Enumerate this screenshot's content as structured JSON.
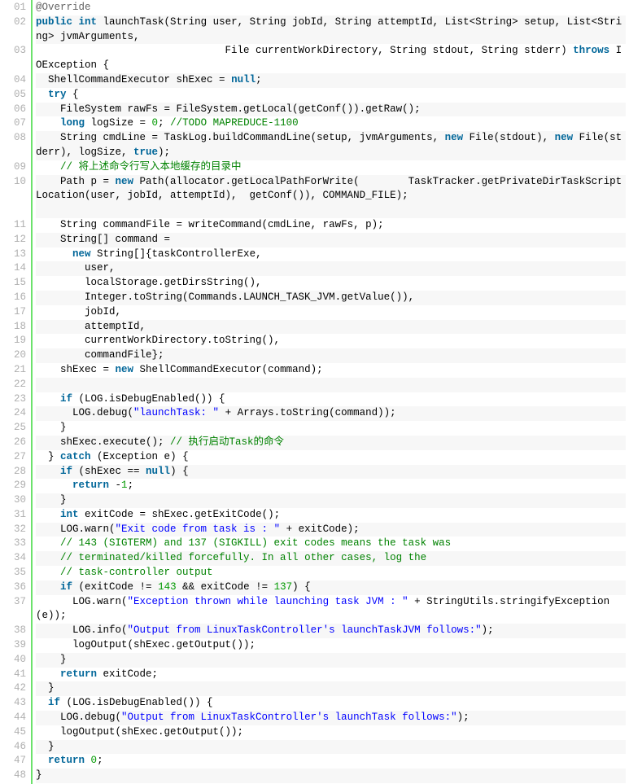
{
  "lines": [
    {
      "num": "01",
      "alt": false,
      "tokens": [
        [
          "anno",
          "@Override"
        ]
      ]
    },
    {
      "num": "02",
      "alt": true,
      "tokens": [
        [
          "kw",
          "public"
        ],
        [
          "plain",
          " "
        ],
        [
          "kw",
          "int"
        ],
        [
          "plain",
          " launchTask(String user, String jobId, String attemptId, List<String> setup, List<String> jvmArguments,"
        ]
      ]
    },
    {
      "num": "03",
      "alt": false,
      "tokens": [
        [
          "plain",
          "                               File currentWorkDirectory, String stdout, String stderr) "
        ],
        [
          "kw",
          "throws"
        ],
        [
          "plain",
          " IOException {"
        ]
      ]
    },
    {
      "num": "04",
      "alt": true,
      "tokens": [
        [
          "plain",
          "  ShellCommandExecutor shExec = "
        ],
        [
          "kw",
          "null"
        ],
        [
          "plain",
          ";"
        ]
      ]
    },
    {
      "num": "05",
      "alt": false,
      "tokens": [
        [
          "plain",
          "  "
        ],
        [
          "kw",
          "try"
        ],
        [
          "plain",
          " {"
        ]
      ]
    },
    {
      "num": "06",
      "alt": true,
      "tokens": [
        [
          "plain",
          "    FileSystem rawFs = FileSystem.getLocal(getConf()).getRaw();"
        ]
      ]
    },
    {
      "num": "07",
      "alt": false,
      "tokens": [
        [
          "plain",
          "    "
        ],
        [
          "kw",
          "long"
        ],
        [
          "plain",
          " logSize = "
        ],
        [
          "num",
          "0"
        ],
        [
          "plain",
          "; "
        ],
        [
          "comm",
          "//TODO MAPREDUCE-1100"
        ]
      ]
    },
    {
      "num": "08",
      "alt": true,
      "tokens": [
        [
          "plain",
          "    String cmdLine = TaskLog.buildCommandLine(setup, jvmArguments, "
        ],
        [
          "kw",
          "new"
        ],
        [
          "plain",
          " File(stdout), "
        ],
        [
          "kw",
          "new"
        ],
        [
          "plain",
          " File(stderr), logSize, "
        ],
        [
          "kw",
          "true"
        ],
        [
          "plain",
          ");"
        ]
      ]
    },
    {
      "num": "09",
      "alt": false,
      "tokens": [
        [
          "plain",
          "    "
        ],
        [
          "comm",
          "// 将上述命令行写入本地缓存的目录中"
        ]
      ]
    },
    {
      "num": "10",
      "alt": true,
      "tokens": [
        [
          "plain",
          "    Path p = "
        ],
        [
          "kw",
          "new"
        ],
        [
          "plain",
          " Path(allocator.getLocalPathForWrite(        TaskTracker.getPrivateDirTaskScriptLocation(user, jobId, attemptId),  getConf()), COMMAND_FILE);"
        ]
      ]
    },
    {
      "num": "11",
      "alt": false,
      "tokens": [
        [
          "plain",
          "    String commandFile = writeCommand(cmdLine, rawFs, p);"
        ]
      ]
    },
    {
      "num": "12",
      "alt": true,
      "tokens": [
        [
          "plain",
          "    String[] command ="
        ]
      ]
    },
    {
      "num": "13",
      "alt": false,
      "tokens": [
        [
          "plain",
          "      "
        ],
        [
          "kw",
          "new"
        ],
        [
          "plain",
          " String[]{taskControllerExe,"
        ]
      ]
    },
    {
      "num": "14",
      "alt": true,
      "tokens": [
        [
          "plain",
          "        user,"
        ]
      ]
    },
    {
      "num": "15",
      "alt": false,
      "tokens": [
        [
          "plain",
          "        localStorage.getDirsString(),"
        ]
      ]
    },
    {
      "num": "16",
      "alt": true,
      "tokens": [
        [
          "plain",
          "        Integer.toString(Commands.LAUNCH_TASK_JVM.getValue()),"
        ]
      ]
    },
    {
      "num": "17",
      "alt": false,
      "tokens": [
        [
          "plain",
          "        jobId,"
        ]
      ]
    },
    {
      "num": "18",
      "alt": true,
      "tokens": [
        [
          "plain",
          "        attemptId,"
        ]
      ]
    },
    {
      "num": "19",
      "alt": false,
      "tokens": [
        [
          "plain",
          "        currentWorkDirectory.toString(),"
        ]
      ]
    },
    {
      "num": "20",
      "alt": true,
      "tokens": [
        [
          "plain",
          "        commandFile};"
        ]
      ]
    },
    {
      "num": "21",
      "alt": false,
      "tokens": [
        [
          "plain",
          "    shExec = "
        ],
        [
          "kw",
          "new"
        ],
        [
          "plain",
          " ShellCommandExecutor(command);"
        ]
      ]
    },
    {
      "num": "22",
      "alt": true,
      "tokens": [
        [
          "plain",
          ""
        ]
      ]
    },
    {
      "num": "23",
      "alt": false,
      "tokens": [
        [
          "plain",
          "    "
        ],
        [
          "kw",
          "if"
        ],
        [
          "plain",
          " (LOG.isDebugEnabled()) {"
        ]
      ]
    },
    {
      "num": "24",
      "alt": true,
      "tokens": [
        [
          "plain",
          "      LOG.debug("
        ],
        [
          "str",
          "\"launchTask: \""
        ],
        [
          "plain",
          " + Arrays.toString(command));"
        ]
      ]
    },
    {
      "num": "25",
      "alt": false,
      "tokens": [
        [
          "plain",
          "    }"
        ]
      ]
    },
    {
      "num": "26",
      "alt": true,
      "tokens": [
        [
          "plain",
          "    shExec.execute(); "
        ],
        [
          "comm",
          "// 执行启动Task的命令"
        ]
      ]
    },
    {
      "num": "27",
      "alt": false,
      "tokens": [
        [
          "plain",
          "  } "
        ],
        [
          "kw",
          "catch"
        ],
        [
          "plain",
          " (Exception e) {"
        ]
      ]
    },
    {
      "num": "28",
      "alt": true,
      "tokens": [
        [
          "plain",
          "    "
        ],
        [
          "kw",
          "if"
        ],
        [
          "plain",
          " (shExec == "
        ],
        [
          "kw",
          "null"
        ],
        [
          "plain",
          ") {"
        ]
      ]
    },
    {
      "num": "29",
      "alt": false,
      "tokens": [
        [
          "plain",
          "      "
        ],
        [
          "kw",
          "return"
        ],
        [
          "plain",
          " -"
        ],
        [
          "num",
          "1"
        ],
        [
          "plain",
          ";"
        ]
      ]
    },
    {
      "num": "30",
      "alt": true,
      "tokens": [
        [
          "plain",
          "    }"
        ]
      ]
    },
    {
      "num": "31",
      "alt": false,
      "tokens": [
        [
          "plain",
          "    "
        ],
        [
          "kw",
          "int"
        ],
        [
          "plain",
          " exitCode = shExec.getExitCode();"
        ]
      ]
    },
    {
      "num": "32",
      "alt": true,
      "tokens": [
        [
          "plain",
          "    LOG.warn("
        ],
        [
          "str",
          "\"Exit code from task is : \""
        ],
        [
          "plain",
          " + exitCode);"
        ]
      ]
    },
    {
      "num": "33",
      "alt": false,
      "tokens": [
        [
          "plain",
          "    "
        ],
        [
          "comm",
          "// 143 (SIGTERM) and 137 (SIGKILL) exit codes means the task was"
        ]
      ]
    },
    {
      "num": "34",
      "alt": true,
      "tokens": [
        [
          "plain",
          "    "
        ],
        [
          "comm",
          "// terminated/killed forcefully. In all other cases, log the"
        ]
      ]
    },
    {
      "num": "35",
      "alt": false,
      "tokens": [
        [
          "plain",
          "    "
        ],
        [
          "comm",
          "// task-controller output"
        ]
      ]
    },
    {
      "num": "36",
      "alt": true,
      "tokens": [
        [
          "plain",
          "    "
        ],
        [
          "kw",
          "if"
        ],
        [
          "plain",
          " (exitCode != "
        ],
        [
          "num",
          "143"
        ],
        [
          "plain",
          " && exitCode != "
        ],
        [
          "num",
          "137"
        ],
        [
          "plain",
          ") {"
        ]
      ]
    },
    {
      "num": "37",
      "alt": false,
      "tokens": [
        [
          "plain",
          "      LOG.warn("
        ],
        [
          "str",
          "\"Exception thrown while launching task JVM : \""
        ],
        [
          "plain",
          " + StringUtils.stringifyException(e));"
        ]
      ]
    },
    {
      "num": "38",
      "alt": true,
      "tokens": [
        [
          "plain",
          "      LOG.info("
        ],
        [
          "str",
          "\"Output from LinuxTaskController's launchTaskJVM follows:\""
        ],
        [
          "plain",
          ");"
        ]
      ]
    },
    {
      "num": "39",
      "alt": false,
      "tokens": [
        [
          "plain",
          "      logOutput(shExec.getOutput());"
        ]
      ]
    },
    {
      "num": "40",
      "alt": true,
      "tokens": [
        [
          "plain",
          "    }"
        ]
      ]
    },
    {
      "num": "41",
      "alt": false,
      "tokens": [
        [
          "plain",
          "    "
        ],
        [
          "kw",
          "return"
        ],
        [
          "plain",
          " exitCode;"
        ]
      ]
    },
    {
      "num": "42",
      "alt": true,
      "tokens": [
        [
          "plain",
          "  }"
        ]
      ]
    },
    {
      "num": "43",
      "alt": false,
      "tokens": [
        [
          "plain",
          "  "
        ],
        [
          "kw",
          "if"
        ],
        [
          "plain",
          " (LOG.isDebugEnabled()) {"
        ]
      ]
    },
    {
      "num": "44",
      "alt": true,
      "tokens": [
        [
          "plain",
          "    LOG.debug("
        ],
        [
          "str",
          "\"Output from LinuxTaskController's launchTask follows:\""
        ],
        [
          "plain",
          ");"
        ]
      ]
    },
    {
      "num": "45",
      "alt": false,
      "tokens": [
        [
          "plain",
          "    logOutput(shExec.getOutput());"
        ]
      ]
    },
    {
      "num": "46",
      "alt": true,
      "tokens": [
        [
          "plain",
          "  }"
        ]
      ]
    },
    {
      "num": "47",
      "alt": false,
      "tokens": [
        [
          "plain",
          "  "
        ],
        [
          "kw",
          "return"
        ],
        [
          "plain",
          " "
        ],
        [
          "num",
          "0"
        ],
        [
          "plain",
          ";"
        ]
      ]
    },
    {
      "num": "48",
      "alt": true,
      "tokens": [
        [
          "plain",
          "}"
        ]
      ]
    }
  ],
  "wrap_extra": {
    "02": 1,
    "03": 1,
    "08": 1,
    "10": 2,
    "37": 1
  }
}
